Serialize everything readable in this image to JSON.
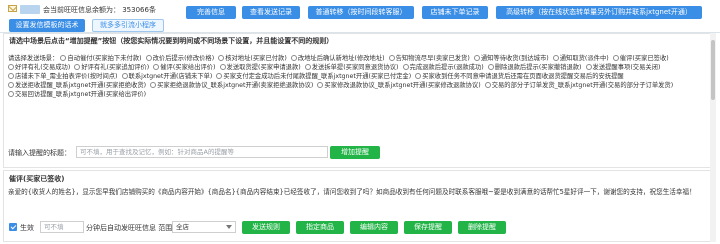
{
  "header": {
    "quota_text": "会当前旺旺信息余额为： 353066条",
    "buttons": [
      {
        "label": "完善信息"
      },
      {
        "label": "查看发送记录"
      },
      {
        "label": "普通转移（按时间段转客服）"
      },
      {
        "label": "店铺未下单记录"
      },
      {
        "label": "高级转移（按在线状态转单量另外订购并联系jxtgnet开通）"
      }
    ],
    "sub_buttons": [
      {
        "label": "设置发信模板的话术"
      },
      {
        "label": "就多多引流小程序"
      }
    ]
  },
  "section1": {
    "title": "请选中场景后点击“增加提醒”按钮（按您实际情况要到明间或不同场景下设置，并且能设置不同的规则）",
    "type_label": "请选择发送场景：",
    "options": [
      "自动催付(买家拍下未付款)",
      "改价后提示(修改价格)",
      "核对地址(买家已付款)",
      "改地址后确认新地址(修改地址)",
      "告知物流尽早(卖家已发货)",
      "通知等待收货(到达城市)",
      "通知取货(派件中)",
      "催评(买家已签收)",
      "好评有礼(交易成功)",
      "好评有礼(买家追加评价)",
      "催评(买家给出评价)",
      "发送取货提(买家申请退款)",
      "发送拆单提(买家同意退货协议)",
      "完成退款后提示(退款成功)",
      "删除退款后提示(买家撤销退款)",
      "发送提醒事项(交易关闭)",
      "店铺未下单_需业拍表评价(按时间点)",
      "联系jxtgnet开通(店铺未下单)",
      "买家支付定金成功后未付尾款提醒_联系jxtgnet开通(买家已付定金)",
      "买家收到任务不同意申请退货后还需在页面收退货提醒交易后的安抚提醒",
      "发送拒收提醒_联系jxtgnet开通(买家拒绝收货)",
      "买家拒绝退款协议_联系jxtgnet开通(卖家拒绝退款协议)",
      "买家修改退款协议_联系jxtgnet开通(买家修改退款协议)",
      "交易的部分子订单发货_联系jxtgnet开通(交易的部分子订单发货)",
      "交易回访提醒_联系jxtgnet开通(买家给出评价)"
    ],
    "title_label": "请输入提醒的标题：",
    "title_placeholder": "可不填，用于查找及记忆，例如：针对商品A的提醒等",
    "add_button": "增加提醒"
  },
  "section2": {
    "title": "催评(买家已签收)",
    "message": "亲爱的{收货人的姓名}，显示您早我们店铺购买的《商品内容开始》{商品名}{商品内容结束}已经签收了，请问您收到了吗？如商品收到有任何问题及时联系客服哦~要是收到满意的话帮忙5星好评一下，谢谢您的支持，祝您生活幸福！",
    "enable_label": "生效",
    "delay_placeholder": "可不填",
    "delay_suffix": "分钟后自动发旺旺信息 范围",
    "scope_value": "全店",
    "buttons": [
      {
        "label": "发送规则"
      },
      {
        "label": "指定商品"
      },
      {
        "label": "编辑内容"
      },
      {
        "label": "保存提醒"
      },
      {
        "label": "删除提醒"
      }
    ]
  },
  "colors": {
    "primary_blue": "#3a8ee6",
    "green": "#22b447"
  }
}
